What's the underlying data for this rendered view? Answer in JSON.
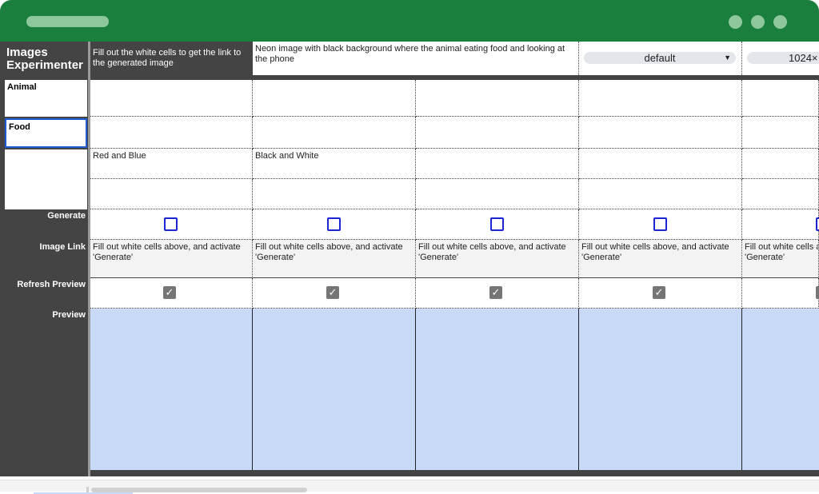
{
  "app": {
    "title": "Images Experimenter"
  },
  "header": {
    "instruction": "Fill out the white cells to get the link to the generated image",
    "prompt": "Neon image with black background where the animal eating food and looking at the phone",
    "style_select": "default",
    "size_select": "1024×"
  },
  "variables": {
    "animal": "Animal",
    "food": "Food",
    "blank3": "",
    "blank4": ""
  },
  "rows": {
    "generate": "Generate",
    "image_link": "Image Link",
    "refresh_preview": "Refresh Preview",
    "preview": "Preview"
  },
  "grid": {
    "animal_row": [
      "",
      "",
      "",
      "",
      ""
    ],
    "food_row": [
      "",
      "",
      "",
      "",
      ""
    ],
    "color_row": [
      "Red and Blue",
      "Black and White",
      "",
      "",
      ""
    ],
    "blank_row": [
      "",
      "",
      "",
      "",
      ""
    ],
    "generate": [
      false,
      false,
      false,
      false,
      false
    ],
    "image_links": [
      "Fill out white cells above, and activate 'Generate'",
      "Fill out white cells above, and activate 'Generate'",
      "Fill out white cells above, and activate 'Generate'",
      "Fill out white cells above, and activate 'Generate'",
      "Fill out white cells a"
    ],
    "image_link_line2": [
      "'Generate'",
      "'Generate'",
      "'Generate'",
      "'Generate'",
      "'Generate'"
    ],
    "refresh": [
      true,
      true,
      true,
      true,
      true
    ]
  },
  "icons": {
    "checked": "check-icon",
    "caret": "caret-down-icon",
    "check_glyph": "✓",
    "caret_glyph": "▼"
  },
  "colors": {
    "titlebar": "#1a7f3c",
    "sidebar": "#444444",
    "preview": "#c9daf8",
    "checkbox_border": "#1c25d4"
  }
}
